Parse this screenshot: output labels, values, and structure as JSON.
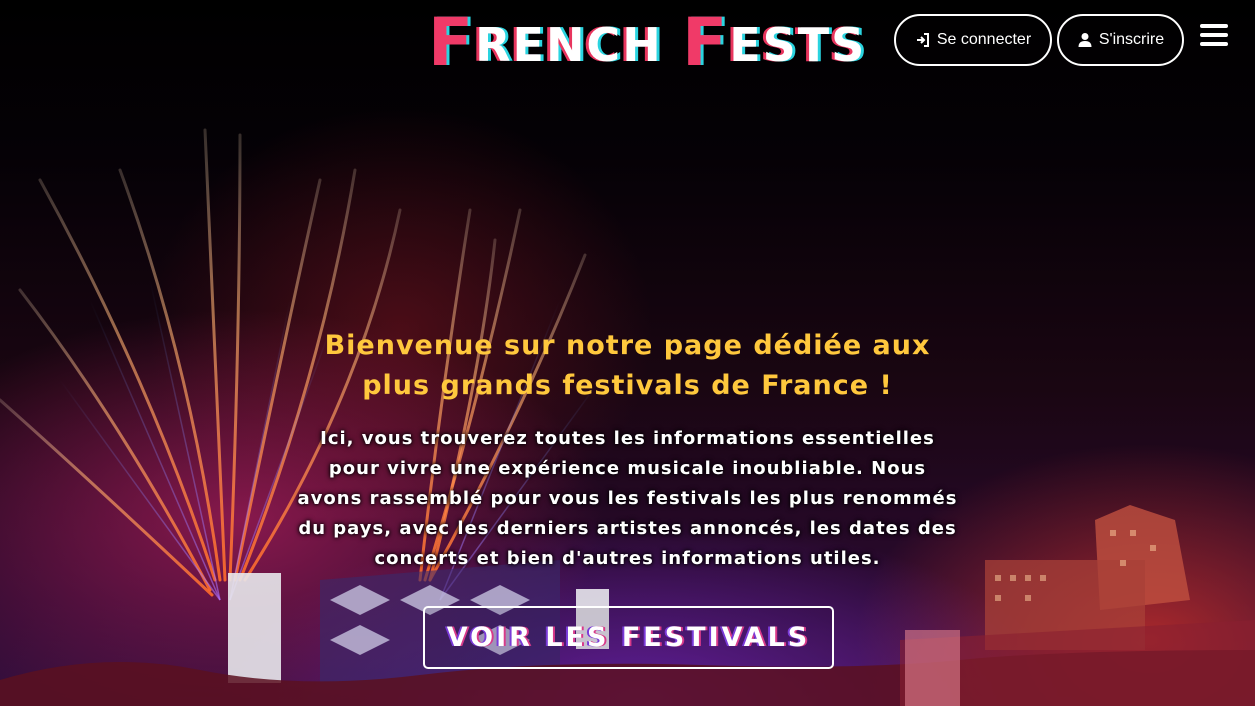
{
  "header": {
    "logo": {
      "first_letter_1": "F",
      "rest_1": "RENCH",
      "first_letter_2": "F",
      "rest_2": "ESTS"
    },
    "login_label": "Se connecter",
    "signup_label": "S'inscrire",
    "menu_icon": "hamburger-menu-icon"
  },
  "hero": {
    "title_line1": "Bienvenue sur notre page dédiée aux",
    "title_line2": "plus grands festivals de France !",
    "text_line1": "Ici, vous trouverez toutes les informations essentielles",
    "text_line2": "pour vivre une expérience musicale inoubliable. Nous",
    "text_line3": "avons rassemblé pour vous les festivals les plus renommés",
    "text_line4": "du pays, avec les derniers artistes annoncés, les dates des",
    "text_line5": "concerts et bien d'autres informations utiles.",
    "cta_label": "VOIR LES FESTIVALS"
  },
  "colors": {
    "title": "#ffc83d",
    "logo_accent": "#f03a68",
    "logo_shadow": "#2ad4e0"
  }
}
